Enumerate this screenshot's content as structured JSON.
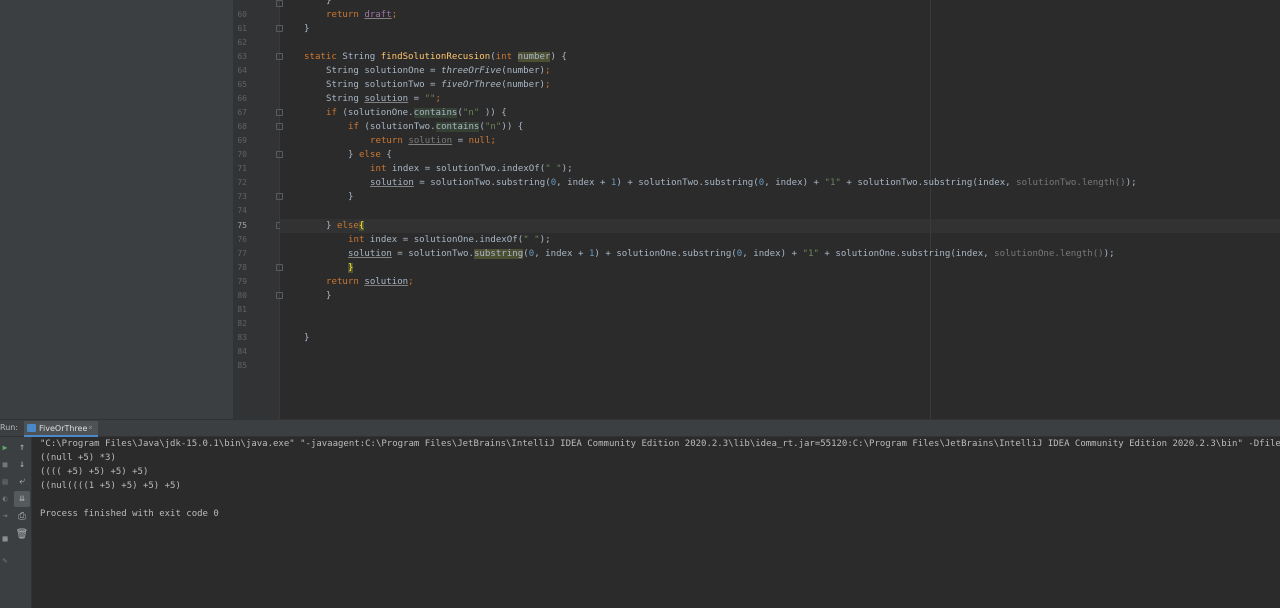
{
  "editor": {
    "line_numbers": [
      "60",
      "61",
      "62",
      "63",
      "64",
      "65",
      "66",
      "67",
      "68",
      "69",
      "70",
      "71",
      "72",
      "73",
      "74",
      "75",
      "76",
      "77",
      "78",
      "79",
      "80",
      "81",
      "82",
      "83",
      "84",
      "85"
    ],
    "current_line": "75",
    "lines": {
      "l59": "}",
      "l60_kw": "return",
      "l60_var": "draft",
      "l61": "}",
      "l63_kw1": "static",
      "l63_type": "String",
      "l63_fn": "findSolutionRecusion",
      "l63_kw2": "int",
      "l63_param": "number",
      "l64_a": "String solutionOne = ",
      "l64_call": "threeOrFive",
      "l64_b": "(number)",
      "l65_a": "String solutionTwo = ",
      "l65_call": "fiveOrThree",
      "l65_b": "(number)",
      "l66_a": "String ",
      "l66_var": "solution",
      "l66_b": " = ",
      "l66_str": "\"\"",
      "l67_kw": "if",
      "l67_a": " (solutionOne.",
      "l67_m": "contains",
      "l67_b": "(",
      "l67_str": "\"n\"",
      "l67_c": " )) {",
      "l68_kw": "if",
      "l68_a": " (solutionTwo.",
      "l68_m": "contains",
      "l68_b": "(",
      "l68_str": "\"n\"",
      "l68_c": ")) {",
      "l69_kw": "return",
      "l69_var": "solution",
      "l69_a": " = ",
      "l69_null": "null",
      "l70_a": "} ",
      "l70_kw": "else",
      "l70_b": " {",
      "l71_kw": "int",
      "l71_a": " index = solutionTwo.indexOf(",
      "l71_str": "\" \"",
      "l71_b": ");",
      "l72_var": "solution",
      "l72_a": " = solutionTwo.substring(",
      "l72_n0": "0",
      "l72_b": ", index + ",
      "l72_n1": "1",
      "l72_c": ") + solutionTwo.substring(",
      "l72_n2": "0",
      "l72_d": ", index) + ",
      "l72_str": "\"1\"",
      "l72_e": " + solutionTwo.substring(index, ",
      "l72_gr": "solutionTwo.length()",
      "l72_f": ");",
      "l73": "}",
      "l75_a": "} ",
      "l75_kw": "else",
      "l75_b": "{",
      "l76_kw": "int",
      "l76_a": " index = solutionOne.indexOf(",
      "l76_str": "\" \"",
      "l76_b": ");",
      "l77_var": "solution",
      "l77_a": " = solutionTwo.",
      "l77_m": "substring",
      "l77_b": "(",
      "l77_n0": "0",
      "l77_c": ", index + ",
      "l77_n1": "1",
      "l77_d": ") + solutionOne.substring(",
      "l77_n2": "0",
      "l77_e": ", index) + ",
      "l77_str": "\"1\"",
      "l77_f": " + solutionOne.substring(index, ",
      "l77_gr": "solutionOne.length()",
      "l77_g": ");",
      "l78": "}",
      "l79_kw": "return",
      "l79_var": "solution",
      "l80": "}",
      "l83": "}"
    }
  },
  "run_panel": {
    "label": "Run:",
    "tab_label": "FiveOrThree",
    "tab_close": "×",
    "console_lines": [
      "\"C:\\Program Files\\Java\\jdk-15.0.1\\bin\\java.exe\" \"-javaagent:C:\\Program Files\\JetBrains\\IntelliJ IDEA Community Edition 2020.2.3\\lib\\idea_rt.jar=55120:C:\\Program Files\\JetBrains\\IntelliJ IDEA Community Edition 2020.2.3\\bin\" -Dfile.",
      "((null +5) *3)",
      "(((( +5) +5) +5) +5)",
      "((nul((((1 +5) +5) +5) +5)",
      "",
      "Process finished with exit code 0"
    ],
    "toolbar_icons": [
      "rerun-icon",
      "stop-icon",
      "scroll-up-icon",
      "scroll-down-icon",
      "soft-wrap-icon",
      "scroll-to-end-icon",
      "print-icon",
      "trash-icon"
    ]
  },
  "colors": {
    "keyword": "#cc7832",
    "function": "#ffc66d",
    "string": "#6a8759",
    "number": "#6897bb",
    "text": "#a9b7c6",
    "background": "#2b2b2b"
  }
}
